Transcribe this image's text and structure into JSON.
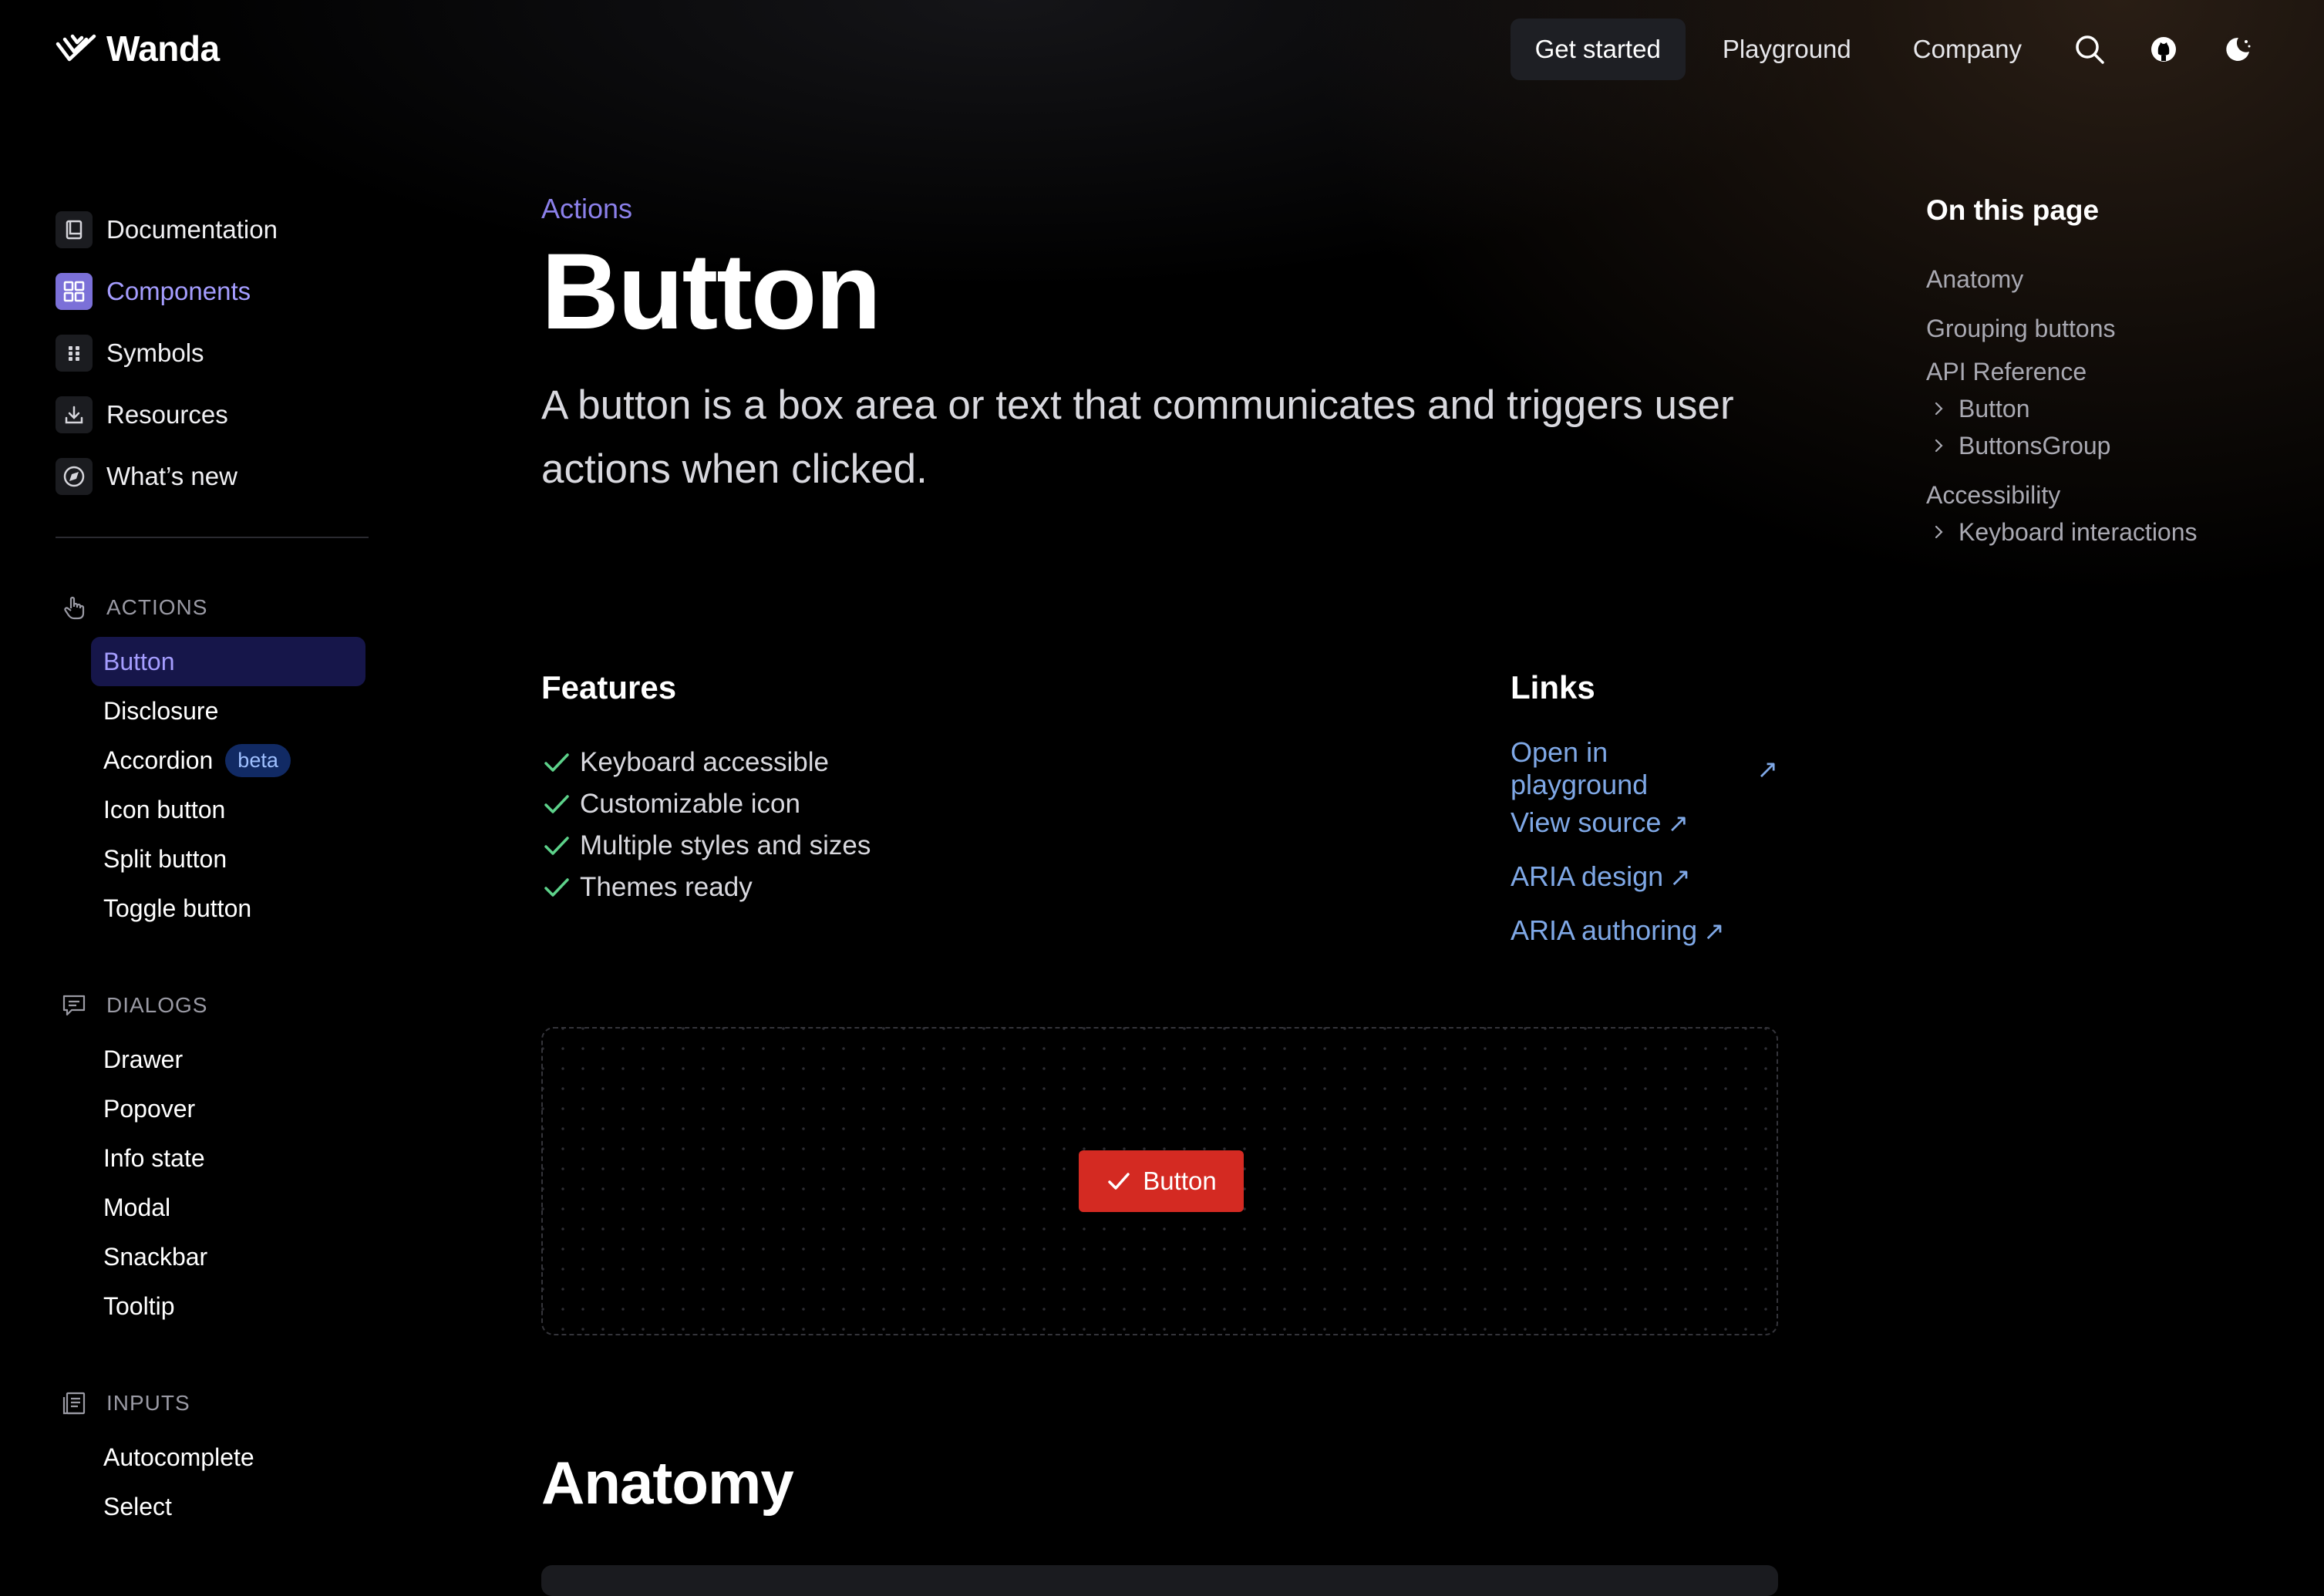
{
  "header": {
    "brand": "Wanda",
    "nav": [
      "Get started",
      "Playground",
      "Company"
    ]
  },
  "icons": {
    "logo": "wanda-logo-icon",
    "search": "search-icon",
    "github": "github-icon",
    "theme": "moon-sun-icon"
  },
  "sidebar": {
    "main": [
      {
        "label": "Documentation",
        "icon": "book-icon"
      },
      {
        "label": "Components",
        "icon": "grid-icon"
      },
      {
        "label": "Symbols",
        "icon": "symbols-icon"
      },
      {
        "label": "Resources",
        "icon": "download-icon"
      },
      {
        "label": "What’s new",
        "icon": "compass-icon"
      }
    ],
    "sections": [
      {
        "title": "ACTIONS",
        "icon": "pointer-hand-icon",
        "items": [
          "Button",
          "Disclosure",
          "Accordion",
          "Icon button",
          "Split button",
          "Toggle button"
        ],
        "badge": "beta"
      },
      {
        "title": "DIALOGS",
        "icon": "chat-icon",
        "items": [
          "Drawer",
          "Popover",
          "Info state",
          "Modal",
          "Snackbar",
          "Tooltip"
        ]
      },
      {
        "title": "INPUTS",
        "icon": "form-icon",
        "items": [
          "Autocomplete",
          "Select"
        ]
      }
    ]
  },
  "main": {
    "eyebrow": "Actions",
    "title": "Button",
    "lede": "A button is a box area or text that communicates and triggers user actions when clicked.",
    "features_title": "Features",
    "features": [
      "Keyboard accessible",
      "Customizable icon",
      "Multiple styles and sizes",
      "Themes ready"
    ],
    "links_title": "Links",
    "links": [
      "Open in playground",
      "View source",
      "ARIA design",
      "ARIA authoring"
    ],
    "link_arrow": "↗",
    "demo_button": "Button",
    "anatomy_title": "Anatomy"
  },
  "toc": {
    "title": "On this page",
    "items": [
      "Anatomy",
      "Grouping buttons",
      "API Reference",
      "Button",
      "ButtonsGroup",
      "Accessibility",
      "Keyboard interactions"
    ]
  },
  "colors": {
    "accent": "#a59dff",
    "link": "#7fa8e6",
    "check": "#5dd28a",
    "demo_button": "#d42a22",
    "active_bg": "#16164a"
  }
}
